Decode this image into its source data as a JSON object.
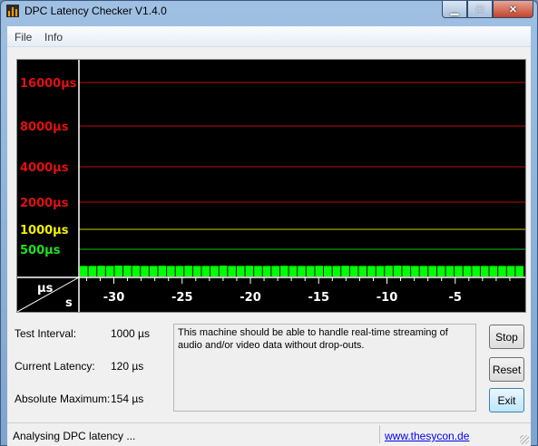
{
  "window": {
    "title": "DPC Latency Checker V1.4.0"
  },
  "menu": {
    "items": [
      "File",
      "Info"
    ]
  },
  "graph": {
    "unit_us": "µs",
    "unit_s": "s",
    "y_labels": [
      {
        "text": "16000µs",
        "color": "#e01010"
      },
      {
        "text": "8000µs",
        "color": "#e01010"
      },
      {
        "text": "4000µs",
        "color": "#e01010"
      },
      {
        "text": "2000µs",
        "color": "#e01010"
      },
      {
        "text": "1000µs",
        "color": "#f0f000"
      },
      {
        "text": "500µs",
        "color": "#20e020"
      }
    ],
    "x_labels": [
      "-30",
      "-25",
      "-20",
      "-15",
      "-10",
      "-5"
    ],
    "bar_color": "#00ff00",
    "bar_levels": [
      0.9,
      0.9,
      0.95,
      0.9,
      1,
      1,
      0.95,
      0.9,
      0.9,
      0.95,
      0.9,
      0.9,
      0.95,
      0.9,
      0.9,
      0.9,
      1,
      0.9,
      0.9,
      0.95,
      0.9,
      0.9,
      0.9,
      0.95,
      0.9,
      0.9,
      0.9,
      0.95,
      0.9,
      0.9,
      0.95,
      0.9,
      0.9,
      0.9,
      0.9,
      0.95,
      1,
      0.95,
      0.9,
      0.9,
      0.9,
      0.9,
      0.9,
      0.9,
      0.9,
      0.9,
      0.9,
      0.9,
      0.9,
      0.9,
      0.9
    ]
  },
  "info": {
    "test_interval_label": "Test Interval:",
    "test_interval_value": "1000 µs",
    "current_latency_label": "Current Latency:",
    "current_latency_value": "120 µs",
    "absolute_max_label": "Absolute Maximum:",
    "absolute_max_value": "154 µs"
  },
  "message": "This machine should be able to handle real-time streaming of audio and/or video data without drop-outs.",
  "buttons": {
    "stop": "Stop",
    "reset": "Reset",
    "exit": "Exit"
  },
  "status": {
    "text": "Analysing DPC latency ...",
    "link": "www.thesycon.de"
  }
}
